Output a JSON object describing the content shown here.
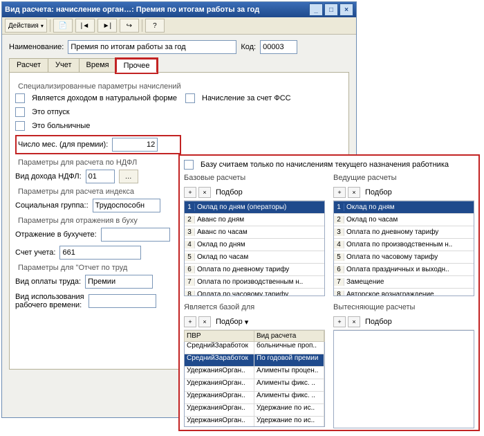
{
  "title": "Вид расчета: начисление орган…: Премия по итогам работы за год",
  "toolbar": {
    "actions": "Действия"
  },
  "form": {
    "name_label": "Наименование:",
    "name_value": "Премия по итогам работы за год",
    "code_label": "Код:",
    "code_value": "00003"
  },
  "tabs": [
    "Расчет",
    "Учет",
    "Время",
    "Прочее"
  ],
  "groups": {
    "g1": "Специализированные параметры начислений",
    "c1": "Является доходом в натуральной форме",
    "c2": "Начисление за счет ФСС",
    "c3": "Это отпуск",
    "c4": "Это больничные",
    "months_label": "Число мес. (для премии):",
    "months_value": "12",
    "g2": "Параметры для расчета по НДФЛ",
    "ndfl_label": "Вид дохода НДФЛ:",
    "ndfl_value": "01",
    "g3": "Параметры для расчета индекса",
    "soc_label": "Социальная группа::",
    "soc_value": "Трудоспособн",
    "g4": "Параметры для отражения в буху",
    "buh_label": "Отражение в бухучете:",
    "acct_label": "Счет учета:",
    "acct_value": "661",
    "g5": "Параметры для \"Отчет по труд",
    "pay_label": "Вид оплаты труда:",
    "pay_value": "Премии",
    "use_label": "Вид использования\nрабочего времени:"
  },
  "overlay": {
    "top_cb": "Базу считаем только по начислениям текущего назначения работника",
    "base_title": "Базовые расчеты",
    "lead_title": "Ведущие расчеты",
    "podb": "Подбор",
    "base_items": [
      "Оклад по дням (операторы)",
      "Аванс по дням",
      "Аванс по часам",
      "Оклад по дням",
      "Оклад по часам",
      "Оплата по дневному тарифу",
      "Оплата по производственным н..",
      "Оплата по часовому тарифу"
    ],
    "lead_items": [
      "Оклад по дням",
      "Оклад по часам",
      "Оплата по дневному тарифу",
      "Оплата по производственным н..",
      "Оплата по часовому тарифу",
      "Оплата праздничных и выходн..",
      "Замещение",
      "Авторское вознаграждение"
    ],
    "isbase_title": "Является базой для",
    "displ_title": "Вытесняющие расчеты",
    "grid_head": [
      "ПВР",
      "Вид расчета"
    ],
    "grid_rows": [
      [
        "СреднийЗаработок",
        "больничные проп.."
      ],
      [
        "СреднийЗаработок",
        "По годовой премии"
      ],
      [
        "УдержанияОрган..",
        "Алименты процен.."
      ],
      [
        "УдержанияОрган..",
        "Алименты фикс. .."
      ],
      [
        "УдержанияОрган..",
        "Алименты фикс. .."
      ],
      [
        "УдержанияОрган..",
        "Удержание по ис.."
      ],
      [
        "УдержанияОрган..",
        "Удержание по ис.."
      ]
    ]
  }
}
